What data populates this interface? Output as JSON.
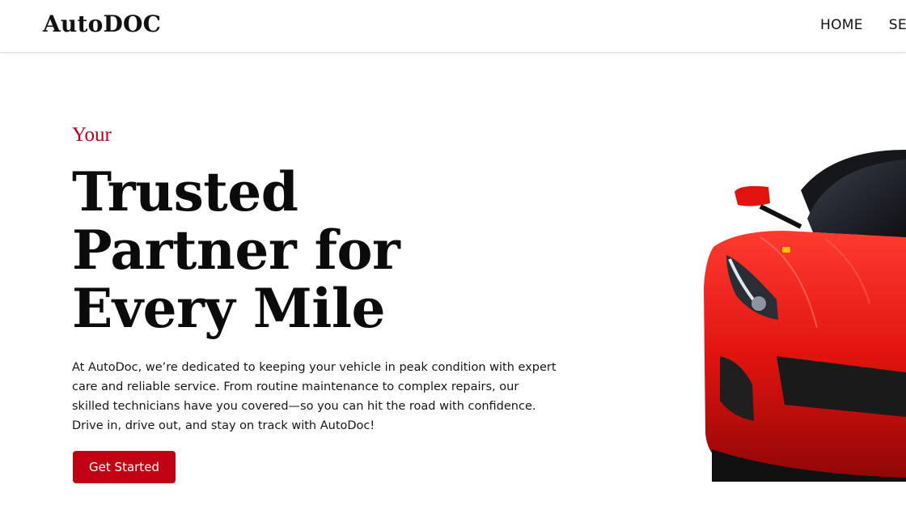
{
  "header": {
    "logo": "AutoDOC",
    "nav": [
      "HOME",
      "SERVICES"
    ]
  },
  "hero": {
    "eyebrow": "Your",
    "title_lines": [
      "Trusted",
      "Partner for",
      "Every Mile"
    ],
    "description": "At AutoDoc, we’re dedicated to keeping your vehicle in peak condition with expert care and reliable service. From routine maintenance to complex repairs, our skilled technicians have you covered—so you can hit the road with confidence. Drive in, drive out, and stay on track with AutoDoc!",
    "cta_label": "Get Started",
    "image": "red-sports-car"
  },
  "colors": {
    "accent": "#c10013",
    "eyebrow": "#b3001b",
    "text": "#111111",
    "background": "#ffffff"
  }
}
